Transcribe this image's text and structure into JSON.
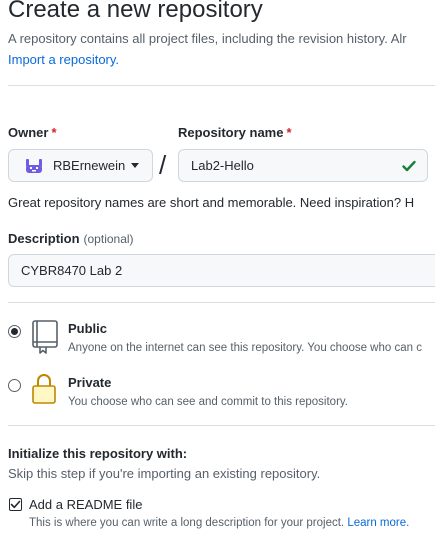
{
  "header": {
    "title": "Create a new repository",
    "subtitle": "A repository contains all project files, including the revision history. Alr",
    "import_link": "Import a repository."
  },
  "owner": {
    "label": "Owner",
    "required_mark": "*",
    "value": "RBErnewein"
  },
  "separator": "/",
  "repo_name": {
    "label": "Repository name",
    "required_mark": "*",
    "value": "Lab2-Hello"
  },
  "name_hint": "Great repository names are short and memorable. Need inspiration? H",
  "description": {
    "label": "Description",
    "optional": "(optional)",
    "value": "CYBR8470 Lab 2"
  },
  "visibility": {
    "selected": "public",
    "public": {
      "title": "Public",
      "desc": "Anyone on the internet can see this repository. You choose who can c"
    },
    "private": {
      "title": "Private",
      "desc": "You choose who can see and commit to this repository."
    }
  },
  "initialize": {
    "title": "Initialize this repository with:",
    "subtitle": "Skip this step if you're importing an existing repository.",
    "readme": {
      "checked": true,
      "label": "Add a README file",
      "desc": "This is where you can write a long description for your project.",
      "link": "Learn more."
    }
  },
  "colors": {
    "link": "#0969da",
    "required": "#cf222e",
    "valid_check": "#1a7f37",
    "owner_avatar": "#6e5ce6",
    "lock_icon": "#bf8700"
  }
}
